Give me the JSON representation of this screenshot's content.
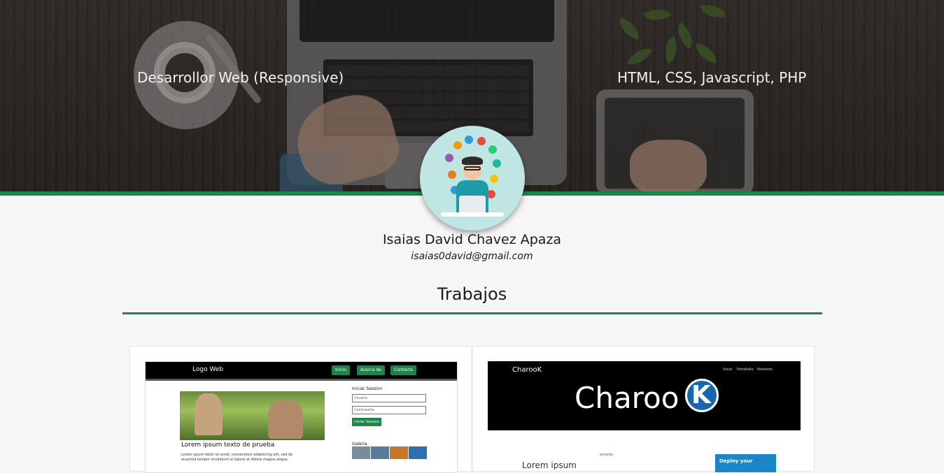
{
  "hero": {
    "tagline_left": "Desarrollor Web (Responsive)",
    "tagline_right": "HTML, CSS, Javascript, PHP"
  },
  "profile": {
    "name": "Isaias David Chavez Apaza",
    "email": "isaias0david@gmail.com"
  },
  "section": {
    "title": "Trabajos"
  },
  "projects": [
    {
      "nav_logo": "Logo Web",
      "nav_buttons": [
        "Inicio",
        "Acerca de",
        "Contacto"
      ],
      "heading": "Lorem ipsum texto de prueba",
      "paragraph": "Lorem ipsum dolor sit amet, consectetur adipisicing elit, sed do eiusmod tempor incididunt ut labore et dolore magna aliqua.",
      "login_title": "Iniciar Session",
      "user_placeholder": "Usuario",
      "pass_placeholder": "Contraseña",
      "login_button": "Iniciar Session",
      "gallery_title": "Galeria"
    },
    {
      "brand_small": "CharooK",
      "nav_links": [
        "Inicio",
        "Portafolio",
        "Nosotros"
      ],
      "brand_big": "Charoo",
      "brand_k": "K",
      "small_red": "enlaces",
      "faded_text": "Lorem ipsum",
      "ad_text": "Deploy your"
    }
  ],
  "colors": {
    "accent_green": "#1e8449",
    "page_bg": "#f6f6f6"
  }
}
